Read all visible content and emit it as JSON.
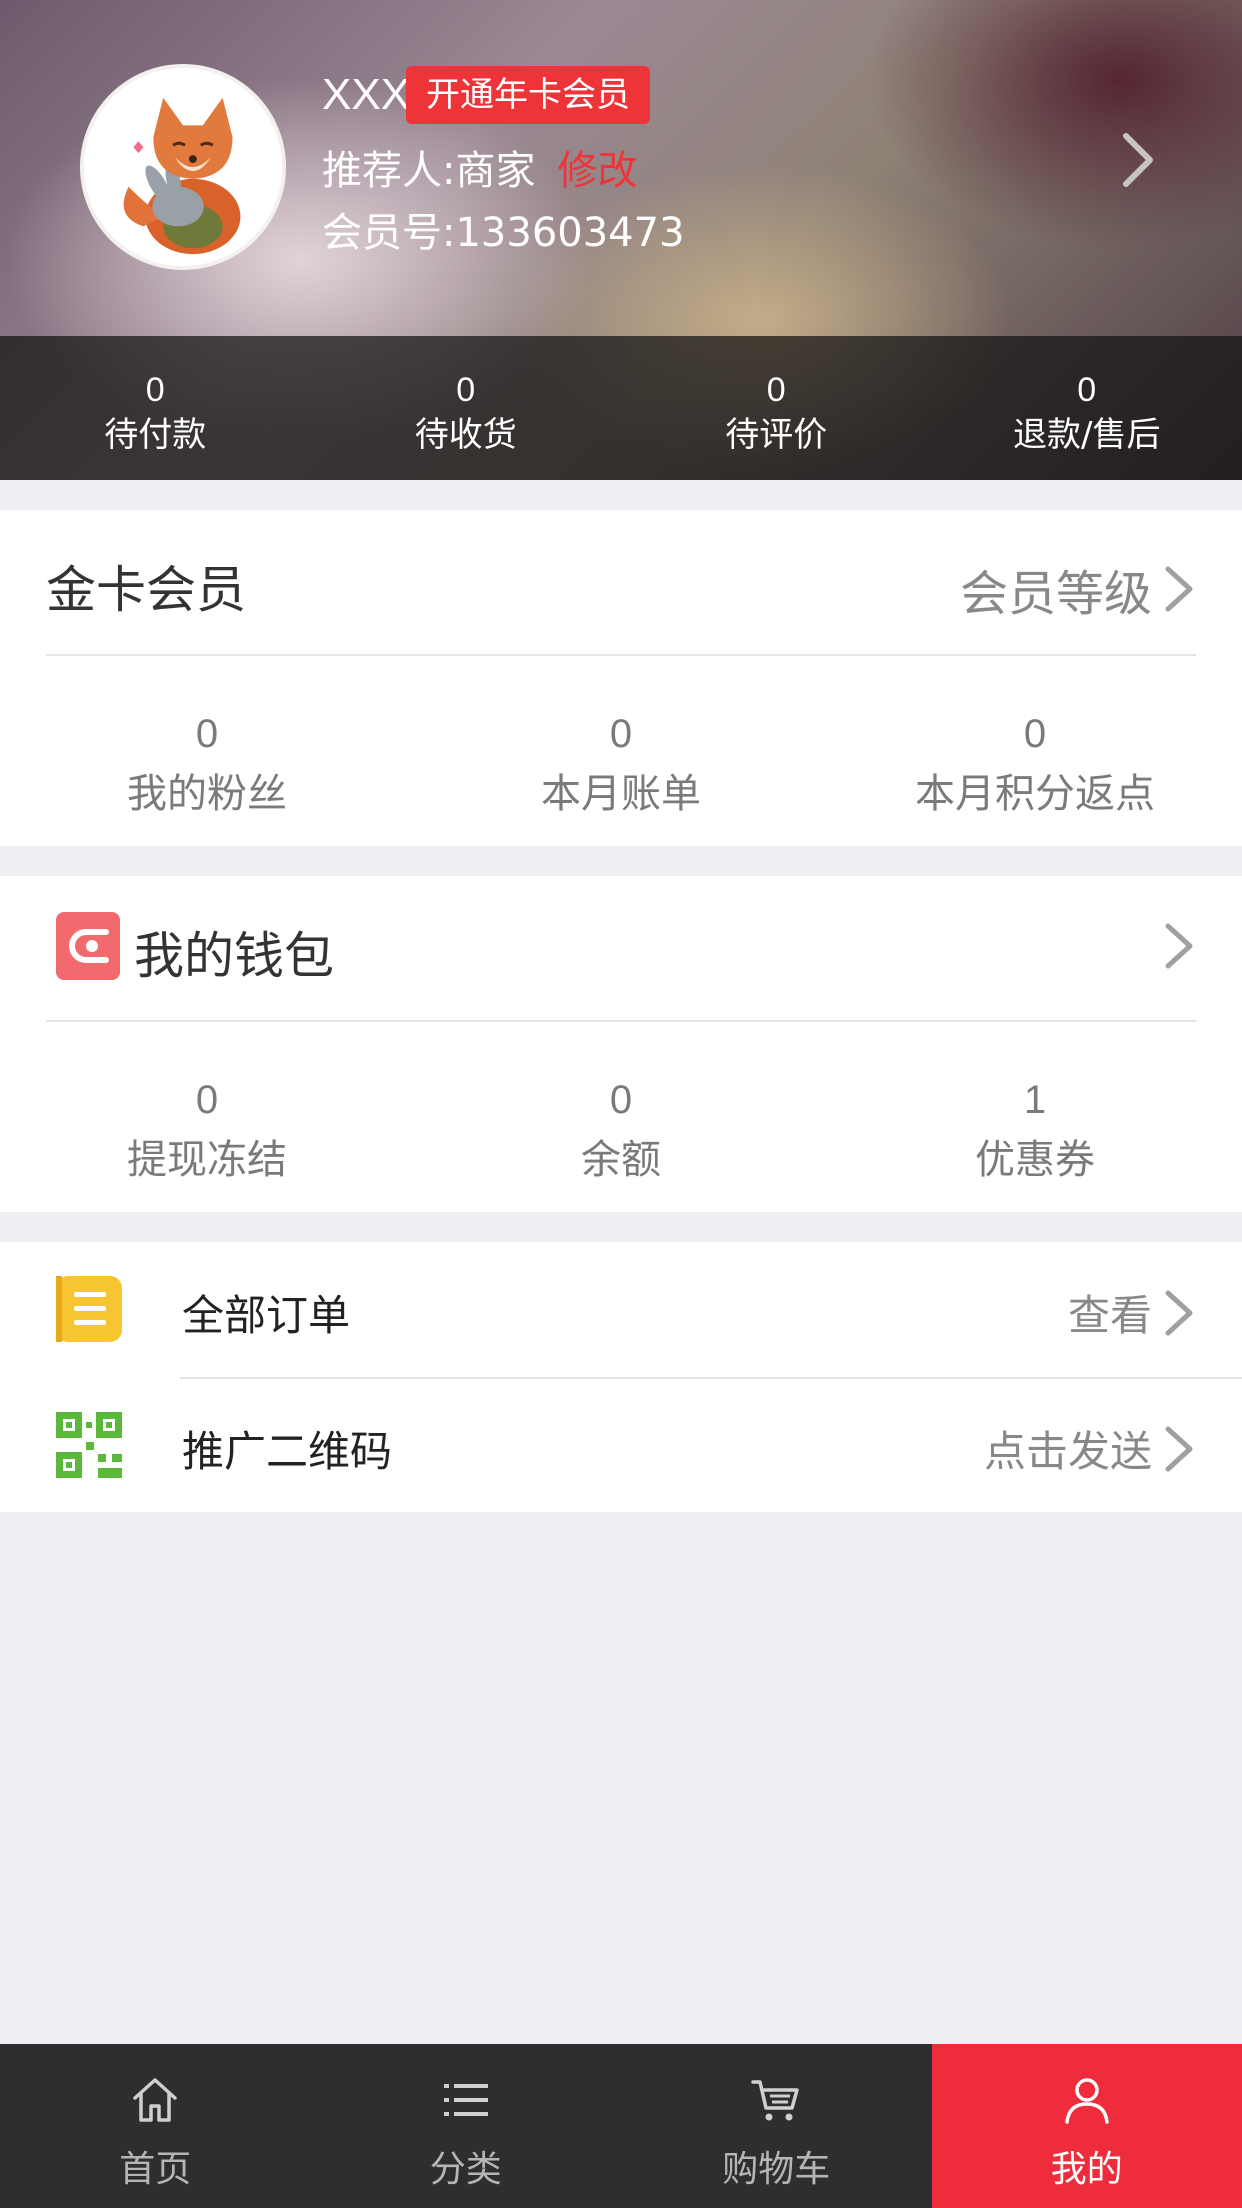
{
  "colors": {
    "accent": "#ee2c3b",
    "badge": "#ee3439",
    "tab_bg": "#2e2e30",
    "page_bg": "#eeeef3"
  },
  "profile": {
    "name": "XXX",
    "vip_badge": "开通年卡会员",
    "referrer": "推荐人:商家",
    "edit": "修改",
    "member_no": "会员号:133603473"
  },
  "orders": [
    {
      "count": "0",
      "label": "待付款"
    },
    {
      "count": "0",
      "label": "待收货"
    },
    {
      "count": "0",
      "label": "待评价"
    },
    {
      "count": "0",
      "label": "退款/售后"
    }
  ],
  "membership": {
    "title": "金卡会员",
    "link": "会员等级",
    "stats": [
      {
        "value": "0",
        "label": "我的粉丝"
      },
      {
        "value": "0",
        "label": "本月账单"
      },
      {
        "value": "0",
        "label": "本月积分返点"
      }
    ]
  },
  "wallet": {
    "title": "我的钱包",
    "icon": "wallet-icon",
    "stats": [
      {
        "value": "0",
        "label": "提现冻结"
      },
      {
        "value": "0",
        "label": "余额"
      },
      {
        "value": "1",
        "label": "优惠券"
      }
    ]
  },
  "menu": [
    {
      "label": "全部订单",
      "action": "查看",
      "icon": "order-list-icon"
    },
    {
      "label": "推广二维码",
      "action": "点击发送",
      "icon": "qr-code-icon"
    }
  ],
  "tabs": [
    {
      "label": "首页",
      "icon": "home-icon"
    },
    {
      "label": "分类",
      "icon": "list-icon"
    },
    {
      "label": "购物车",
      "icon": "cart-icon"
    },
    {
      "label": "我的",
      "icon": "user-icon",
      "active": true
    }
  ]
}
